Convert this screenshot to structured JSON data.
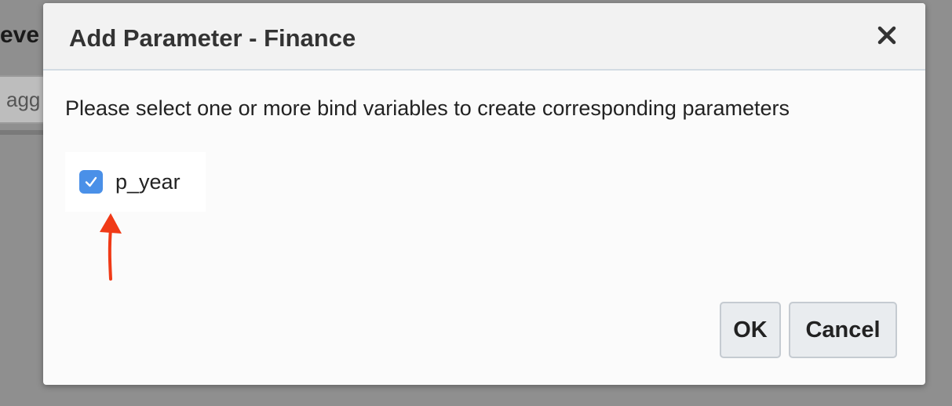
{
  "background": {
    "title_fragment": "eve",
    "input_fragment": "agg"
  },
  "dialog": {
    "title": "Add Parameter - Finance",
    "close_icon": "close-icon",
    "instructions": "Please select one or more bind variables to create corresponding parameters",
    "bind_variables": [
      {
        "label": "p_year",
        "checked": true
      }
    ],
    "ok_label": "OK",
    "cancel_label": "Cancel"
  },
  "colors": {
    "checkbox_accent": "#4a90e8",
    "annotation_arrow": "#f03a17"
  }
}
